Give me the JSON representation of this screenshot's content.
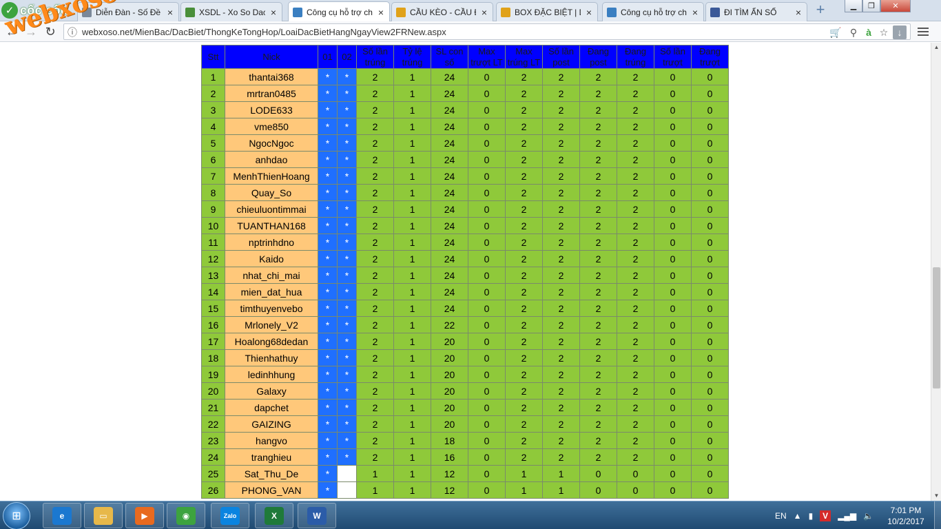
{
  "browser": {
    "brand": "cốc cốc",
    "tabs": [
      {
        "label": "Diễn Đàn - Số Đề",
        "fav": "doc-icon",
        "fav_color": "#7a8899",
        "active": false
      },
      {
        "label": "XSDL - Xo So Dac",
        "fav": "chrome-icon",
        "fav_color": "#4a8f3a",
        "active": false
      },
      {
        "label": "Công cụ hỗ trợ chơ",
        "fav": "tool-icon",
        "fav_color": "#3a7fc1",
        "active": true
      },
      {
        "label": "CẦU KÈO - CẦU Đ",
        "fav": "xs-icon",
        "fav_color": "#e0a21a",
        "active": false
      },
      {
        "label": "BOX ĐẶC BIỆT | Di",
        "fav": "xs-icon",
        "fav_color": "#e0a21a",
        "active": false
      },
      {
        "label": "Công cụ hỗ trợ chơ",
        "fav": "tool-icon",
        "fav_color": "#3a7fc1",
        "active": false
      },
      {
        "label": "ĐI TÌM ẨN SỐ",
        "fav": "facebook-icon",
        "fav_color": "#3b5998",
        "active": false
      }
    ],
    "url": "webxoso.net/MienBac/DacBiet/ThongKeTongHop/LoaiDacBietHangNgayView2FRNew.aspx"
  },
  "watermark": "webxoso.net",
  "table": {
    "headers": [
      "Stt",
      "Nick",
      "01",
      "02",
      "Số lần trúng",
      "Tỷ lệ trúng",
      "SL con số",
      "Max trượt LT",
      "Max trúng LT",
      "Số lần post",
      "Đang post",
      "Đang trúng",
      "Số lần trượt",
      "Đang trượt"
    ],
    "rows": [
      {
        "stt": "1",
        "nick": "thantai368",
        "f1": "*",
        "f2": "*",
        "v": [
          "2",
          "1",
          "24",
          "0",
          "2",
          "2",
          "2",
          "2",
          "0",
          "0"
        ]
      },
      {
        "stt": "2",
        "nick": "mrtran0485",
        "f1": "*",
        "f2": "*",
        "v": [
          "2",
          "1",
          "24",
          "0",
          "2",
          "2",
          "2",
          "2",
          "0",
          "0"
        ]
      },
      {
        "stt": "3",
        "nick": "LODE633",
        "f1": "*",
        "f2": "*",
        "v": [
          "2",
          "1",
          "24",
          "0",
          "2",
          "2",
          "2",
          "2",
          "0",
          "0"
        ]
      },
      {
        "stt": "4",
        "nick": "vme850",
        "f1": "*",
        "f2": "*",
        "v": [
          "2",
          "1",
          "24",
          "0",
          "2",
          "2",
          "2",
          "2",
          "0",
          "0"
        ]
      },
      {
        "stt": "5",
        "nick": "NgocNgoc",
        "f1": "*",
        "f2": "*",
        "v": [
          "2",
          "1",
          "24",
          "0",
          "2",
          "2",
          "2",
          "2",
          "0",
          "0"
        ]
      },
      {
        "stt": "6",
        "nick": "anhdao",
        "f1": "*",
        "f2": "*",
        "v": [
          "2",
          "1",
          "24",
          "0",
          "2",
          "2",
          "2",
          "2",
          "0",
          "0"
        ]
      },
      {
        "stt": "7",
        "nick": "MenhThienHoang",
        "f1": "*",
        "f2": "*",
        "v": [
          "2",
          "1",
          "24",
          "0",
          "2",
          "2",
          "2",
          "2",
          "0",
          "0"
        ]
      },
      {
        "stt": "8",
        "nick": "Quay_So",
        "f1": "*",
        "f2": "*",
        "v": [
          "2",
          "1",
          "24",
          "0",
          "2",
          "2",
          "2",
          "2",
          "0",
          "0"
        ]
      },
      {
        "stt": "9",
        "nick": "chieuluontimmai",
        "f1": "*",
        "f2": "*",
        "v": [
          "2",
          "1",
          "24",
          "0",
          "2",
          "2",
          "2",
          "2",
          "0",
          "0"
        ]
      },
      {
        "stt": "10",
        "nick": "TUANTHAN168",
        "f1": "*",
        "f2": "*",
        "v": [
          "2",
          "1",
          "24",
          "0",
          "2",
          "2",
          "2",
          "2",
          "0",
          "0"
        ]
      },
      {
        "stt": "11",
        "nick": "nptrinhdno",
        "f1": "*",
        "f2": "*",
        "v": [
          "2",
          "1",
          "24",
          "0",
          "2",
          "2",
          "2",
          "2",
          "0",
          "0"
        ]
      },
      {
        "stt": "12",
        "nick": "Kaido",
        "f1": "*",
        "f2": "*",
        "v": [
          "2",
          "1",
          "24",
          "0",
          "2",
          "2",
          "2",
          "2",
          "0",
          "0"
        ]
      },
      {
        "stt": "13",
        "nick": "nhat_chi_mai",
        "f1": "*",
        "f2": "*",
        "v": [
          "2",
          "1",
          "24",
          "0",
          "2",
          "2",
          "2",
          "2",
          "0",
          "0"
        ]
      },
      {
        "stt": "14",
        "nick": "mien_dat_hua",
        "f1": "*",
        "f2": "*",
        "v": [
          "2",
          "1",
          "24",
          "0",
          "2",
          "2",
          "2",
          "2",
          "0",
          "0"
        ]
      },
      {
        "stt": "15",
        "nick": "timthuyenvebo",
        "f1": "*",
        "f2": "*",
        "v": [
          "2",
          "1",
          "24",
          "0",
          "2",
          "2",
          "2",
          "2",
          "0",
          "0"
        ]
      },
      {
        "stt": "16",
        "nick": "Mrlonely_V2",
        "f1": "*",
        "f2": "*",
        "v": [
          "2",
          "1",
          "22",
          "0",
          "2",
          "2",
          "2",
          "2",
          "0",
          "0"
        ]
      },
      {
        "stt": "17",
        "nick": "Hoalong68dedan",
        "f1": "*",
        "f2": "*",
        "v": [
          "2",
          "1",
          "20",
          "0",
          "2",
          "2",
          "2",
          "2",
          "0",
          "0"
        ]
      },
      {
        "stt": "18",
        "nick": "Thienhathuy",
        "f1": "*",
        "f2": "*",
        "v": [
          "2",
          "1",
          "20",
          "0",
          "2",
          "2",
          "2",
          "2",
          "0",
          "0"
        ]
      },
      {
        "stt": "19",
        "nick": "ledinhhung",
        "f1": "*",
        "f2": "*",
        "v": [
          "2",
          "1",
          "20",
          "0",
          "2",
          "2",
          "2",
          "2",
          "0",
          "0"
        ]
      },
      {
        "stt": "20",
        "nick": "Galaxy",
        "f1": "*",
        "f2": "*",
        "v": [
          "2",
          "1",
          "20",
          "0",
          "2",
          "2",
          "2",
          "2",
          "0",
          "0"
        ]
      },
      {
        "stt": "21",
        "nick": "dapchet",
        "f1": "*",
        "f2": "*",
        "v": [
          "2",
          "1",
          "20",
          "0",
          "2",
          "2",
          "2",
          "2",
          "0",
          "0"
        ]
      },
      {
        "stt": "22",
        "nick": "GAIZING",
        "f1": "*",
        "f2": "*",
        "v": [
          "2",
          "1",
          "20",
          "0",
          "2",
          "2",
          "2",
          "2",
          "0",
          "0"
        ]
      },
      {
        "stt": "23",
        "nick": "hangvo",
        "f1": "*",
        "f2": "*",
        "v": [
          "2",
          "1",
          "18",
          "0",
          "2",
          "2",
          "2",
          "2",
          "0",
          "0"
        ]
      },
      {
        "stt": "24",
        "nick": "tranghieu",
        "f1": "*",
        "f2": "*",
        "v": [
          "2",
          "1",
          "16",
          "0",
          "2",
          "2",
          "2",
          "2",
          "0",
          "0"
        ]
      },
      {
        "stt": "25",
        "nick": "Sat_Thu_De",
        "f1": "*",
        "f2": "",
        "v": [
          "1",
          "1",
          "12",
          "0",
          "1",
          "1",
          "0",
          "0",
          "0",
          "0"
        ]
      },
      {
        "stt": "26",
        "nick": "PHONG_VAN",
        "f1": "*",
        "f2": "",
        "v": [
          "1",
          "1",
          "12",
          "0",
          "1",
          "1",
          "0",
          "0",
          "0",
          "0"
        ]
      }
    ]
  },
  "colors": {
    "header_bg": "#0000ff",
    "stt_bg": "#8fc93a",
    "nick_bg": "#ffc87a",
    "flag_bg": "#1f6fff",
    "num_bg": "#8fc93a"
  },
  "taskbar": {
    "apps": [
      {
        "name": "ie-icon",
        "glyph": "e",
        "color": "#1b78d0"
      },
      {
        "name": "explorer-icon",
        "glyph": "▭",
        "color": "#e7b84a"
      },
      {
        "name": "media-player-icon",
        "glyph": "▶",
        "color": "#e86a1f"
      },
      {
        "name": "coccoc-icon",
        "glyph": "◉",
        "color": "#3da33f"
      },
      {
        "name": "zalo-icon",
        "glyph": "Zalo",
        "color": "#0a84e0"
      },
      {
        "name": "excel-icon",
        "glyph": "X",
        "color": "#1f7a3a"
      },
      {
        "name": "word-icon",
        "glyph": "W",
        "color": "#2b5ca8"
      }
    ],
    "language": "EN",
    "time": "7:01 PM",
    "date": "10/2/2017"
  }
}
